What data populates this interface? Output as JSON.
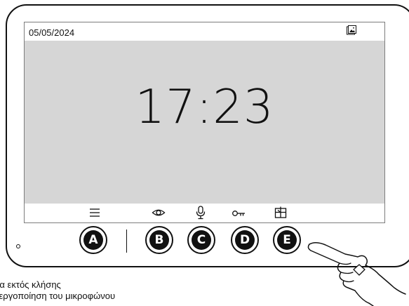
{
  "screen": {
    "date": "05/05/2024",
    "time": "17:23",
    "gallery_icon": "image-gallery-icon"
  },
  "icon_bar": [
    "menu-icon",
    "eye-icon",
    "microphone-icon",
    "key-icon",
    "door-icon"
  ],
  "buttons": [
    {
      "label": "A"
    },
    {
      "label": "B"
    },
    {
      "label": "C"
    },
    {
      "label": "D"
    },
    {
      "label": "E"
    }
  ],
  "captions": [
    "ρα εκτός κλήσης",
    "νεργοποίηση του μικροφώνου"
  ]
}
